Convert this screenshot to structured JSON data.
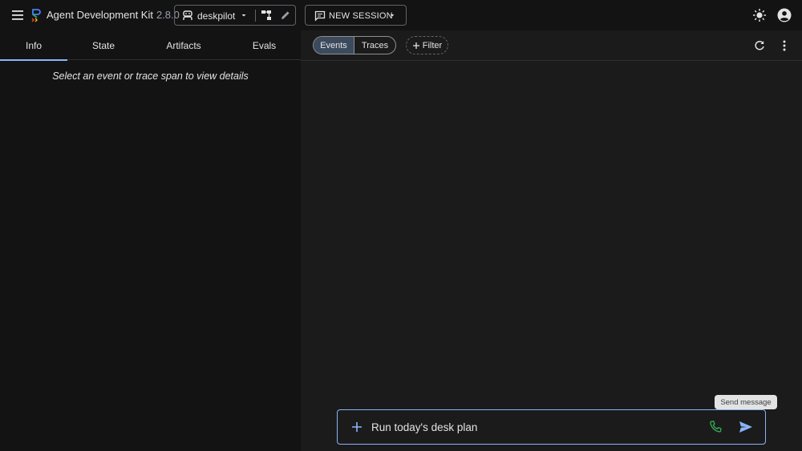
{
  "header": {
    "title": "Agent Development Kit",
    "version": "2.8.0",
    "agent": {
      "name": "deskpilot"
    },
    "new_session_label": "NEW SESSION"
  },
  "left_panel": {
    "tabs": [
      {
        "label": "Info",
        "active": true
      },
      {
        "label": "State",
        "active": false
      },
      {
        "label": "Artifacts",
        "active": false
      },
      {
        "label": "Evals",
        "active": false
      }
    ],
    "empty_message": "Select an event or trace span to view details"
  },
  "right_panel": {
    "view_toggle": [
      {
        "label": "Events",
        "selected": true
      },
      {
        "label": "Traces",
        "selected": false
      }
    ],
    "filter_label": "Filter",
    "tooltip": "Send message",
    "input": {
      "value": "Run today's desk plan"
    }
  },
  "icons": {
    "menu": "menu-icon",
    "logo": "adk-logo-icon",
    "agent": "robot-icon",
    "graph": "graph-icon",
    "edit": "pencil-icon",
    "session": "chat-icon",
    "theme": "sun-icon",
    "account": "account-circle-icon",
    "refresh": "refresh-icon",
    "more": "more-vert-icon",
    "attach": "plus-icon",
    "call": "phone-icon",
    "send": "send-icon"
  },
  "colors": {
    "accent": "#8ab4f8",
    "call_green": "#34a853",
    "selected_toggle": "#3c4a5e"
  }
}
